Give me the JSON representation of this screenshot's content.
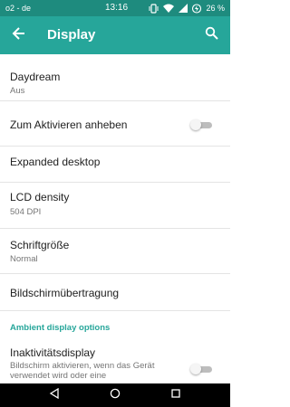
{
  "status_bar": {
    "carrier": "o2 - de",
    "time": "13:16",
    "battery_percent": "26 %",
    "icons": [
      "vibrate-icon",
      "wifi-icon",
      "signal-icon",
      "battery-charging-icon"
    ]
  },
  "app_bar": {
    "title": "Display",
    "back_icon": "arrow-back-icon",
    "search_icon": "search-icon"
  },
  "settings": {
    "daydream": {
      "title": "Daydream",
      "summary": "Aus"
    },
    "lift_to_wake": {
      "title": "Zum Aktivieren anheben",
      "enabled": false
    },
    "expanded_desktop": {
      "title": "Expanded desktop"
    },
    "lcd_density": {
      "title": "LCD density",
      "summary": "504 DPI"
    },
    "font_size": {
      "title": "Schriftgröße",
      "summary": "Normal"
    },
    "cast_screen": {
      "title": "Bildschirmübertragung"
    },
    "ambient_category": "Ambient display options",
    "ambient_display": {
      "title": "Inaktivitätsdisplay",
      "summary_line1": "Bildschirm aktivieren, wenn das Gerät",
      "summary_line2": "verwendet wird oder eine",
      "enabled": false
    }
  },
  "colors": {
    "status_bar": "#1e8b7e",
    "app_bar": "#26a69a",
    "accent": "#26a69a"
  },
  "nav_bar": {
    "icons": [
      "nav-back-icon",
      "nav-home-icon",
      "nav-recents-icon"
    ]
  }
}
